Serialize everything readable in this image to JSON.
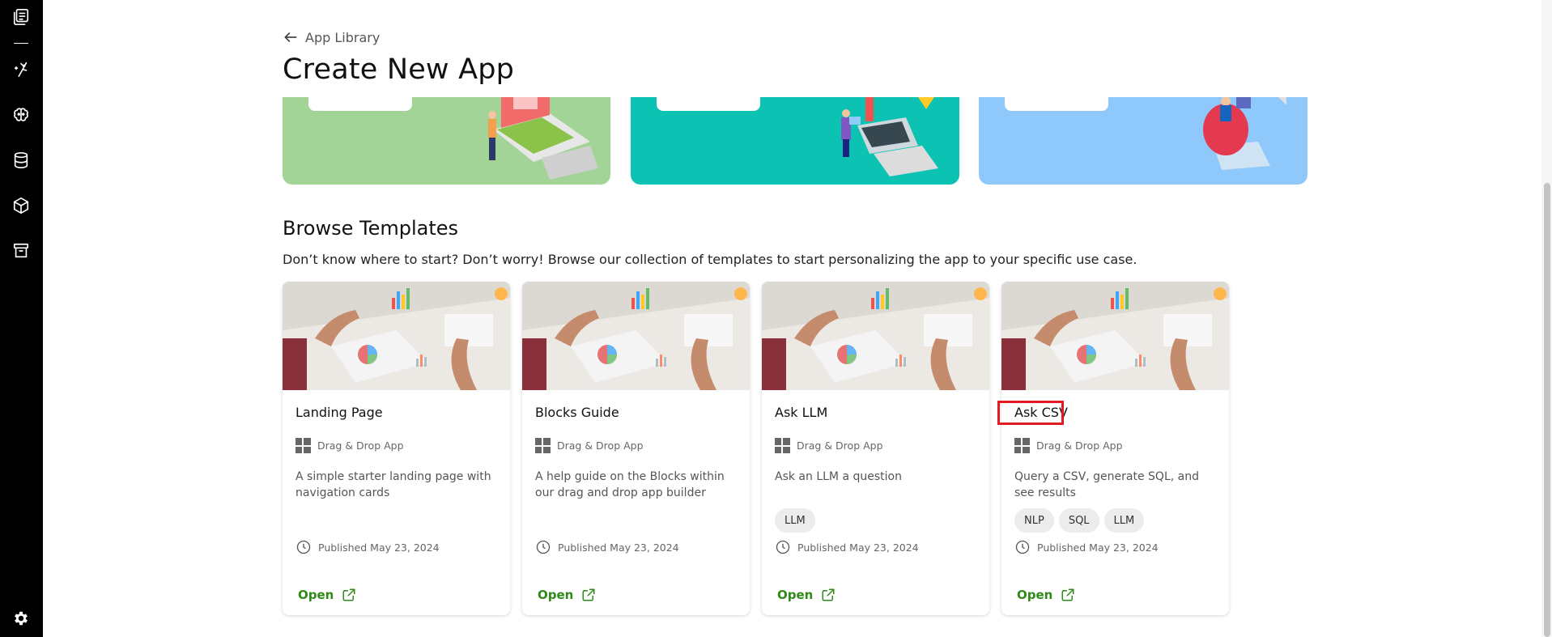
{
  "header": {
    "back_label": "App Library",
    "title": "Create New App"
  },
  "sidebar": {
    "icons": [
      "library-icon",
      "magic-icon",
      "brain-icon",
      "database-icon",
      "cube-icon",
      "archive-icon",
      "settings-icon"
    ]
  },
  "templates": {
    "title": "Browse Templates",
    "subtitle": "Don’t know where to start? Don’t worry! Browse our collection of templates to start personalizing the app to your specific use case.",
    "cards": [
      {
        "title": "Landing Page",
        "type": "Drag & Drop App",
        "description": "A simple starter landing page with navigation cards",
        "tags": [],
        "date": "Published May 23, 2024",
        "open_label": "Open"
      },
      {
        "title": "Blocks Guide",
        "type": "Drag & Drop App",
        "description": "A help guide on the Blocks within our drag and drop app builder",
        "tags": [],
        "date": "Published May 23, 2024",
        "open_label": "Open"
      },
      {
        "title": "Ask LLM",
        "type": "Drag & Drop App",
        "description": "Ask an LLM a question",
        "tags": [
          "LLM"
        ],
        "date": "Published May 23, 2024",
        "open_label": "Open"
      },
      {
        "title": "Ask CSV",
        "type": "Drag & Drop App",
        "description": "Query a CSV, generate SQL, and see results",
        "tags": [
          "NLP",
          "SQL",
          "LLM"
        ],
        "date": "Published May 23, 2024",
        "open_label": "Open"
      }
    ]
  },
  "colors": {
    "banner_green": "#a3d497",
    "banner_teal": "#0bc2b3",
    "banner_blue": "#8fc8fb",
    "open_green": "#2e8b19",
    "highlight_red": "#e01b24"
  }
}
